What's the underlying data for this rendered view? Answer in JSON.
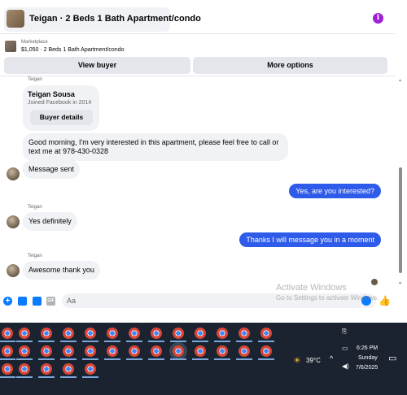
{
  "header": {
    "title": "Teigan · 2 Beds 1 Bath Apartment/condo",
    "info_icon": "i"
  },
  "marketplace": {
    "label": "Marketplace",
    "listing": "$1,050 · 2 Beds 1 Bath Apartment/condo",
    "view_buyer": "View buyer",
    "more_options": "More options"
  },
  "messages": {
    "card": {
      "sender": "Teigan",
      "name": "Teigan Sousa",
      "joined": "Joined Facebook in 2014",
      "button": "Buyer details"
    },
    "m1": "Good morning, I'm very interested in this apartment, please feel free to call or text me at 978-430-0328",
    "m2": "Message sent",
    "m3": "Yes, are you interested?",
    "m4_sender": "Teigan",
    "m4": "Yes definitely",
    "m5": "Thanks I will message you in a moment",
    "m6_sender": "Teigan",
    "m6": "Awesome thank you"
  },
  "composer": {
    "placeholder": "Aa",
    "gif_label": "GIF",
    "plus": "+"
  },
  "watermark": {
    "line1": "Activate Windows",
    "line2": "Go to Settings to activate Windows."
  },
  "taskbar": {
    "weather": "39°C",
    "time": "6:26 PM",
    "day": "Sunday",
    "date": "7/6/2025"
  }
}
